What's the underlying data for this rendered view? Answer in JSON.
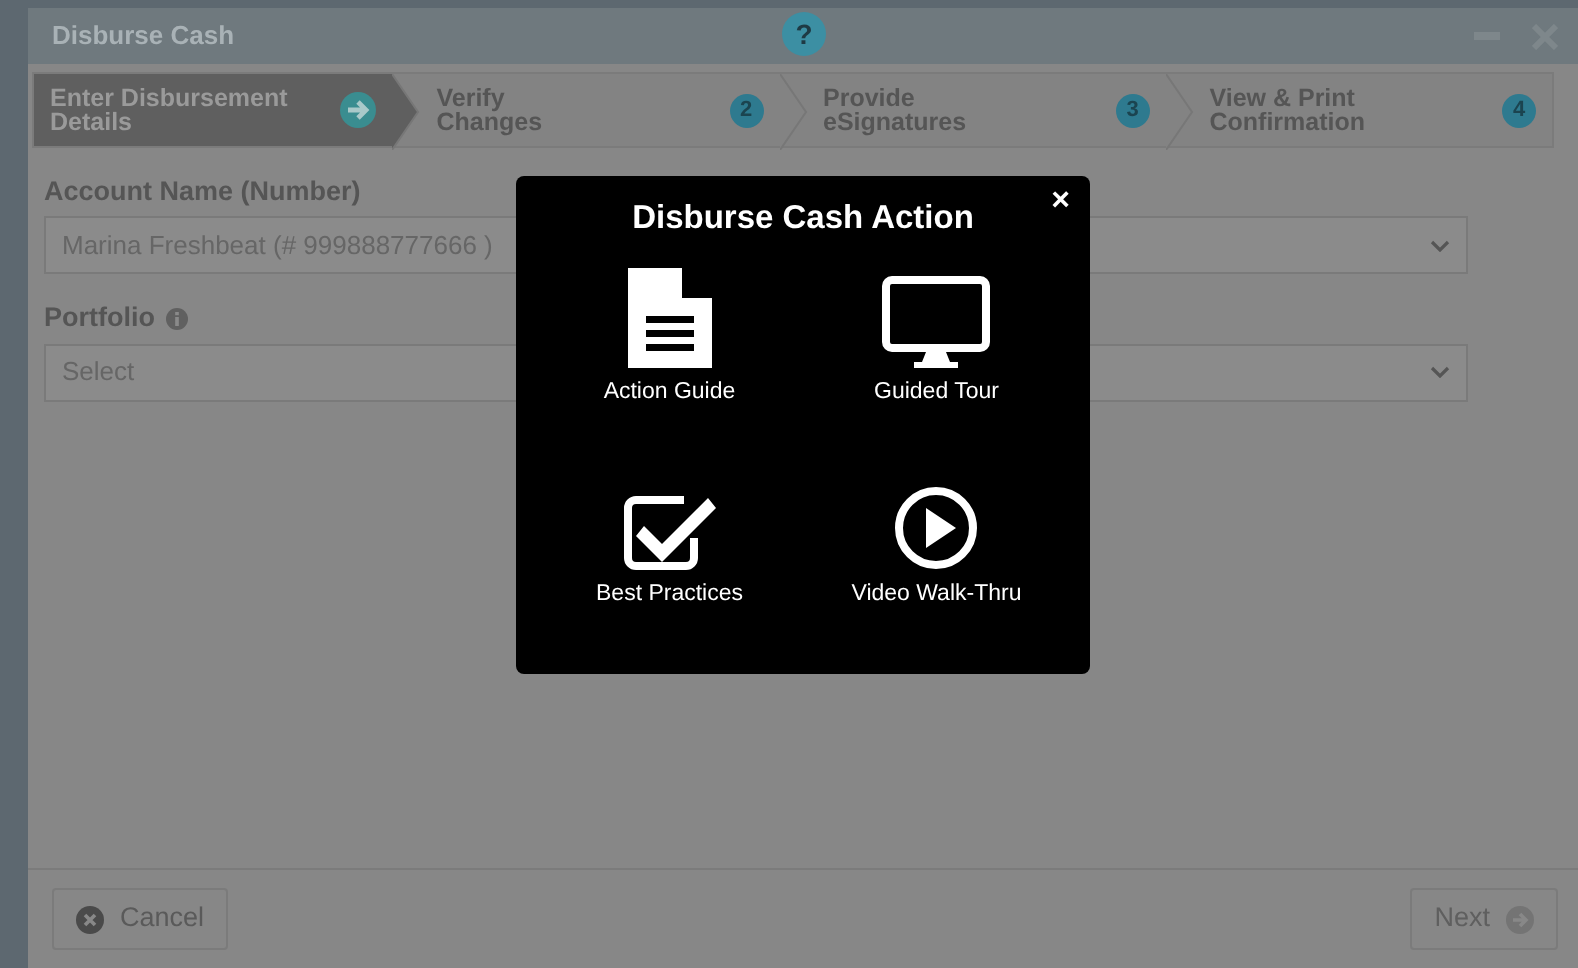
{
  "window": {
    "title": "Disburse Cash",
    "help": "?"
  },
  "steps": [
    {
      "label_lines": [
        "Enter Disbursement",
        "Details"
      ],
      "selected": true
    },
    {
      "label_lines": [
        "Verify",
        "Changes"
      ],
      "number": "2",
      "selected": false
    },
    {
      "label_lines": [
        "Provide",
        "eSignatures"
      ],
      "number": "3",
      "selected": false
    },
    {
      "label_lines": [
        "View & Print",
        "Confirmation"
      ],
      "number": "4",
      "selected": false
    }
  ],
  "fields": [
    {
      "label": "Account Name (Number)",
      "value": "Marina Freshbeat (# 999888777666 )"
    },
    {
      "label": "Portfolio",
      "placeholder": "Select",
      "info": true
    }
  ],
  "modal": {
    "title": "Disburse Cash Action",
    "close": "×",
    "items": [
      {
        "kind": "document",
        "label": "Action Guide"
      },
      {
        "kind": "monitor",
        "label": "Guided Tour"
      },
      {
        "kind": "checkbox",
        "label": "Best Practices"
      },
      {
        "kind": "play",
        "label": "Video Walk-Thru"
      }
    ]
  },
  "buttons": [
    {
      "kind": "cancel",
      "label": "Cancel"
    },
    {
      "kind": "next",
      "label": "Next",
      "disabled": true
    }
  ]
}
